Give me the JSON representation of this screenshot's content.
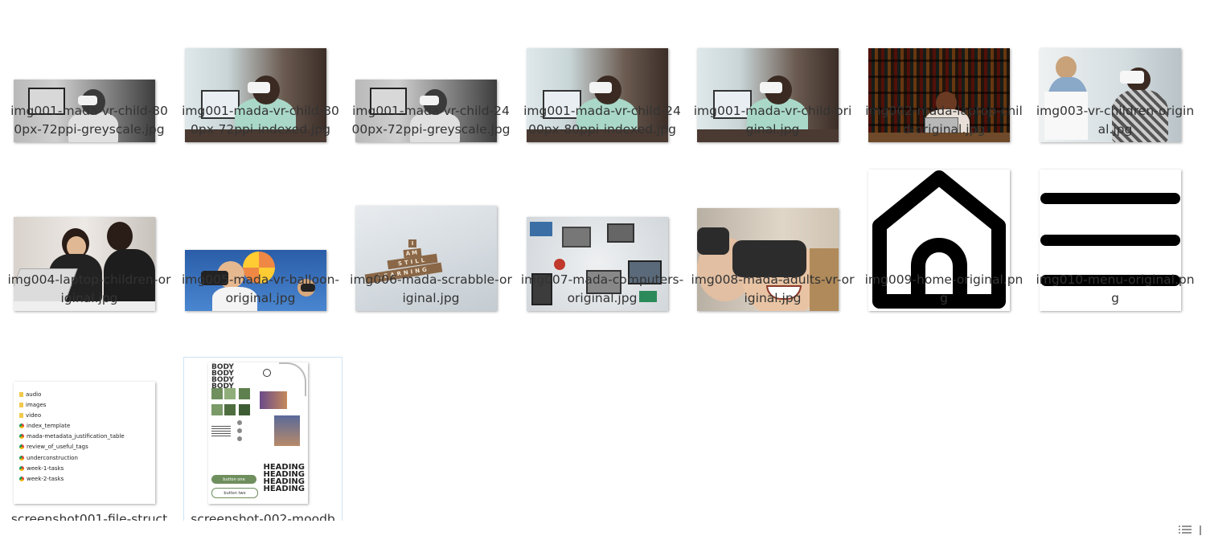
{
  "files": [
    {
      "name": "img001-mada-vr-child-800px-72ppi-greyscale.jpg",
      "thumb": "vr-child-grey"
    },
    {
      "name": "img001-mada-vr-child-800px-72ppi-indexed.jpg",
      "thumb": "vr-child-color"
    },
    {
      "name": "img001-mada-vr-child-2400px-72ppi-greyscale.jpg",
      "thumb": "vr-child-grey"
    },
    {
      "name": "img001-mada-vr-child-2400px-80ppi-indexed.jpg",
      "thumb": "vr-child-color"
    },
    {
      "name": "img001-mada-vr-child-original.jpg",
      "thumb": "vr-child-color"
    },
    {
      "name": "img002-mada-laptop-child-original.jpg",
      "thumb": "library-laptop"
    },
    {
      "name": "img003-vr-children-original.jpg",
      "thumb": "vr-children"
    },
    {
      "name": "img004-laptop-children-original.jpg",
      "thumb": "laptop-children"
    },
    {
      "name": "img005-mada-vr-balloon-original.jpg",
      "thumb": "vr-balloon"
    },
    {
      "name": "img006-mada-scrabble-original.jpg",
      "thumb": "scrabble"
    },
    {
      "name": "img007-mada-computers-original.jpg",
      "thumb": "computers"
    },
    {
      "name": "img008-mada-adults-vr-original.jpg",
      "thumb": "adults-vr"
    },
    {
      "name": "img009-home-original.png",
      "thumb": "home-icon"
    },
    {
      "name": "img010-menu-original.png",
      "thumb": "menu-icon"
    },
    {
      "name": "screenshot001-file-struct",
      "thumb": "file-structure"
    },
    {
      "name": "screenshot-002-moodb",
      "thumb": "moodboard"
    }
  ],
  "scrabble_words": [
    "I",
    "AM",
    "STILL",
    "LEARNING"
  ],
  "file_structure_items": [
    {
      "label": "audio",
      "icon": "folder-icon"
    },
    {
      "label": "images",
      "icon": "folder-icon"
    },
    {
      "label": "video",
      "icon": "folder-icon"
    },
    {
      "label": "index_template",
      "icon": "chrome-icon"
    },
    {
      "label": "mada-metadata_justification_table",
      "icon": "chrome-icon"
    },
    {
      "label": "review_of_useful_tags",
      "icon": "chrome-icon"
    },
    {
      "label": "underconstruction",
      "icon": "chrome-icon"
    },
    {
      "label": "week-1-tasks",
      "icon": "chrome-icon"
    },
    {
      "label": "week-2-tasks",
      "icon": "chrome-icon"
    }
  ],
  "moodboard": {
    "body_text": "BODY",
    "heading_text": "HEADING",
    "button1": "button one",
    "button2": "button two",
    "green": "#6f8f5e"
  },
  "colors": {
    "selection_border": "#cfe3f5",
    "label_text": "#333333"
  }
}
